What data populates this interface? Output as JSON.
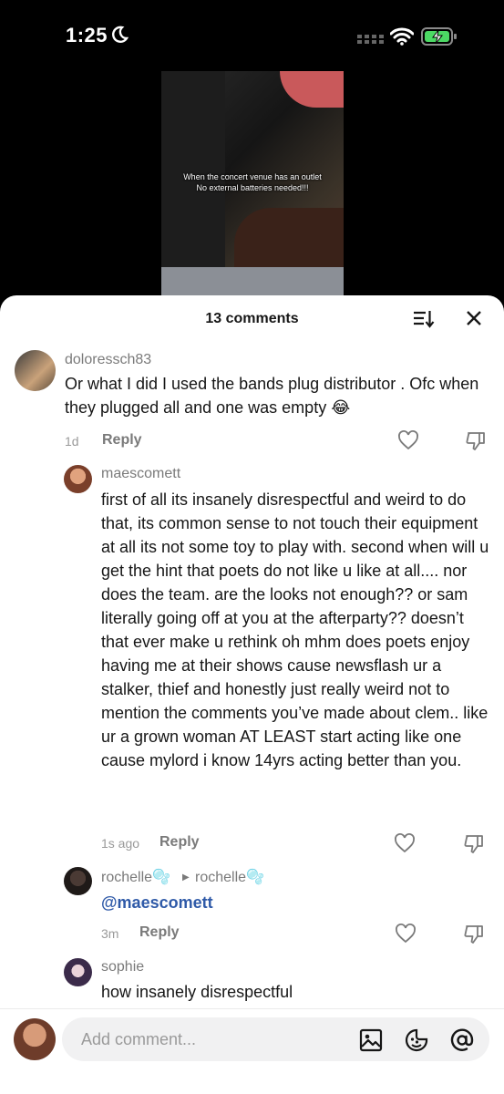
{
  "status": {
    "time": "1:25"
  },
  "video": {
    "caption_line1": "When the concert venue has an outlet",
    "caption_line2": "No external batteries needed!!!"
  },
  "sheet": {
    "title": "13 comments"
  },
  "comments": [
    {
      "username": "doloressch83",
      "text": "Or what I did I used the bands plug distributor . Ofc when they plugged all and one was empty 😂",
      "time": "1d",
      "reply_label": "Reply"
    },
    {
      "username": "maescomett",
      "text": "first of all its insanely disrespectful and weird to do that, its common sense to not touch their equipment at all its not some toy to play with. second when will u get the hint that poets do not like u like at all.... nor does the team. are the looks not enough?? or sam literally going off at you at the afterparty?? doesn’t that ever make u rethink oh mhm does poets enjoy having me at their shows cause newsflash ur a stalker, thief and honestly just really weird not to mention the comments you’ve made about clem.. like ur a grown woman AT LEAST start acting like one cause mylord i know 14yrs acting better than you.",
      "time": "1s ago",
      "reply_label": "Reply"
    },
    {
      "username": "rochelle🫧",
      "reply_to": "rochelle🫧",
      "mention": "@maescomett",
      "time": "3m",
      "reply_label": "Reply"
    },
    {
      "username": "sophie",
      "text": "how insanely disrespectful"
    }
  ],
  "input": {
    "placeholder": "Add comment..."
  }
}
